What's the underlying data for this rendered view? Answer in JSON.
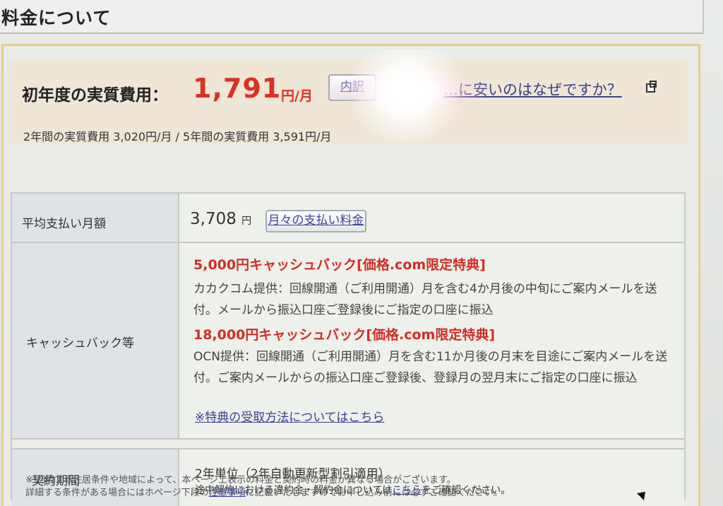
{
  "header": {
    "title": "料金について"
  },
  "cost_summary": {
    "first_year_label": "初年度の実質費用：",
    "first_year_value": "1,791",
    "first_year_unit": "円/月",
    "breakdown_button": "内訳",
    "why_link": "…に安いのはなぜですか？",
    "secondary_line": "2年間の実質費用 3,020円/月 / 5年間の実質費用 3,591円/月"
  },
  "details": {
    "monthly_label": "平均支払い月額",
    "monthly_value": "3,708",
    "monthly_unit": "円",
    "monthly_button": "月々の支払い料金",
    "cashback_label": "キャッシュバック等",
    "benefit_1_title": "5,000円キャッシュバック[価格.com限定特典]",
    "benefit_1_text": "カカクコム提供：回線開通（ご利用開通）月を含む4か月後の中旬にご案内メールを送付。メールから振込口座ご登録後にご指定の口座に振込",
    "benefit_2_title": "18,000円キャッシュバック[価格.com限定特典]",
    "benefit_2_text": "OCN提供：回線開通（ご利用開通）月を含む11か月後の月末を目途にご案内メールを送付。ご案内メールからの振込口座ご登録後、登録月の翌月末にご指定の口座に振込",
    "benefit_link": "※特典の受取方法についてはこちら",
    "term_label": "契約期間",
    "term_value": "2年単位（2年自動更新型割引適用）",
    "term_note_before": "途中解約における違約金・解約金については",
    "term_note_link": "こちら",
    "term_note_after": "をご確認ください。"
  },
  "footer": {
    "note_1": "※ 利用する住居条件や地域によって、本ページ上表示の料金と契約時の料金が異なる場合がございます。",
    "note_2_before": "詳細する条件がある場合にはホページ下段の",
    "note_2_link": "注意事項",
    "note_2_after": "に記載いたしますのでお申し込み前には必ずご確認ください。"
  },
  "colors": {
    "accent_red": "#d83225",
    "link_blue": "#3a3f8e",
    "border_gold": "#e8cf8a"
  }
}
